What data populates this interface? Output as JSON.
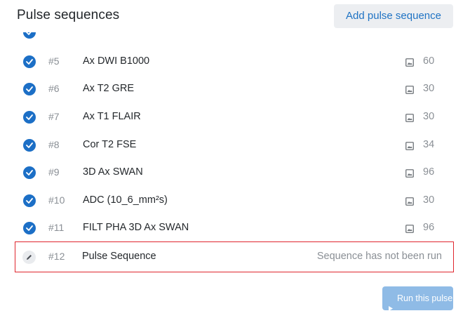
{
  "header": {
    "title": "Pulse sequences",
    "add_button_label": "Add pulse sequence"
  },
  "sequences": [
    {
      "number": "#5",
      "name": "Ax DWI B1000",
      "count": "60",
      "status": "complete"
    },
    {
      "number": "#6",
      "name": "Ax T2 GRE",
      "count": "30",
      "status": "complete"
    },
    {
      "number": "#7",
      "name": "Ax T1 FLAIR",
      "count": "30",
      "status": "complete"
    },
    {
      "number": "#8",
      "name": "Cor T2 FSE",
      "count": "34",
      "status": "complete"
    },
    {
      "number": "#9",
      "name": "3D Ax SWAN",
      "count": "96",
      "status": "complete"
    },
    {
      "number": "#10",
      "name": "ADC (10_6_mm²s)",
      "count": "30",
      "status": "complete"
    },
    {
      "number": "#11",
      "name": "FILT PHA 3D Ax SWAN",
      "count": "96",
      "status": "complete"
    }
  ],
  "pending_sequence": {
    "number": "#12",
    "name": "Pulse Sequence",
    "status_text": "Sequence has not been run"
  },
  "run_button_label": "Run this pulse",
  "icons": {
    "complete": "check-circle-icon",
    "image": "image-icon",
    "edit": "pencil-icon",
    "run": "play-icon"
  },
  "colors": {
    "accent": "#1c6fc6",
    "highlight_border": "#e0262e",
    "run_button_disabled": "#8fbbe6"
  }
}
